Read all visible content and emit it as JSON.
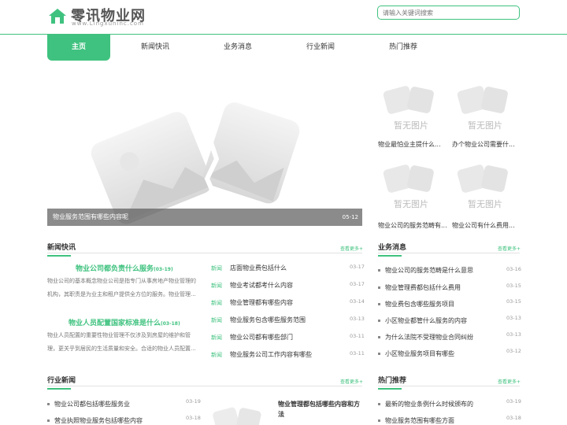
{
  "site": {
    "title": "零讯物业网",
    "domain_text": "www.Lingxuninc.com"
  },
  "search": {
    "placeholder": "请输入关键词搜索"
  },
  "nav": [
    "主页",
    "新闻快讯",
    "业务消息",
    "行业新闻",
    "热门推荐"
  ],
  "banner": {
    "caption": "物业服务范围有哪些内容呢",
    "date": "05-12"
  },
  "placeholder_text": "暂无图片",
  "thumbs": [
    {
      "caption": "物业最怕业主提什么..."
    },
    {
      "caption": "办个物业公司需要什..."
    },
    {
      "caption": "物业公司的服务范畴有..."
    },
    {
      "caption": "物业公司有什么费用..."
    }
  ],
  "news": {
    "title": "新闻快讯",
    "more": "查看更多+",
    "features": [
      {
        "title": "物业公司都负责什么服务",
        "date": "(03-19)",
        "desc": "物业公司的基本概念物业公司是指专门从事房地产物业管理的机构，其职责是为业主和租户提供全方位的服务。物业管理..."
      },
      {
        "title": "物业人员配置国家标准是什么",
        "date": "(03-18)",
        "desc": "物业人员配置的重要性物业管理不仅涉及到房屋的维护和管理，更关乎到居民的生活质量和安全。合适的物业人员配置..."
      }
    ],
    "items": [
      {
        "cat": "新闻",
        "text": "店面物业费包括什么",
        "date": "03-17"
      },
      {
        "cat": "新闻",
        "text": "物业考试都考什么内容",
        "date": "03-17"
      },
      {
        "cat": "新闻",
        "text": "物业管理都有哪些内容",
        "date": "03-14"
      },
      {
        "cat": "新闻",
        "text": "物业服务包含哪些服务范围",
        "date": "03-13"
      },
      {
        "cat": "新闻",
        "text": "物业公司都有哪些部门",
        "date": "03-11"
      },
      {
        "cat": "新闻",
        "text": "物业服务公司工作内容有哪些",
        "date": "03-11"
      }
    ]
  },
  "business": {
    "title": "业务消息",
    "more": "查看更多+",
    "items": [
      {
        "text": "物业公司的服务范畴是什么意思",
        "date": "03-16"
      },
      {
        "text": "物业管理费都包括什么费用",
        "date": "03-15"
      },
      {
        "text": "物业费包含哪些服务项目",
        "date": "03-15"
      },
      {
        "text": "小区物业都管什么服务的内容",
        "date": "03-13"
      },
      {
        "text": "为什么法院不受理物业合同纠纷",
        "date": "03-13"
      },
      {
        "text": "小区物业服务项目有哪些",
        "date": "03-12"
      }
    ]
  },
  "industry": {
    "title": "行业新闻",
    "more": "查看更多+",
    "items": [
      {
        "text": "物业公司都包括哪些服务业",
        "date": "03-19"
      },
      {
        "text": "营业执照物业服务包括哪些内容",
        "date": "03-18"
      }
    ],
    "feature_title_1": "物业管理都包括哪些内容和方",
    "feature_title_2": "法"
  },
  "hot": {
    "title": "热门推荐",
    "more": "查看更多+",
    "items": [
      {
        "text": "最新的物业条例什么时候颁布的",
        "date": "03-19"
      },
      {
        "text": "物业服务范围有哪些方面",
        "date": "03-18"
      }
    ]
  },
  "colors": {
    "accent": "#3fc27f"
  }
}
